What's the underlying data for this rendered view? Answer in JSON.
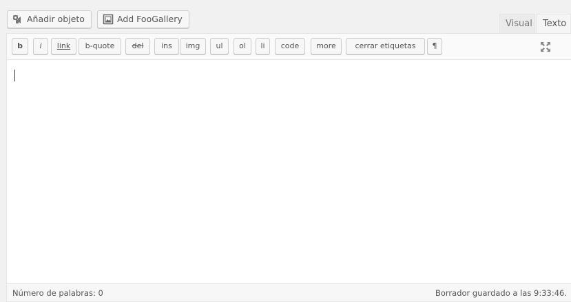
{
  "media_buttons": {
    "add_media": {
      "label": "Añadir objeto",
      "icon": "media-icon"
    },
    "add_foogallery": {
      "label": "Add FooGallery",
      "icon": "gallery-icon"
    }
  },
  "editor_tabs": {
    "visual": "Visual",
    "text": "Texto",
    "active": "Texto"
  },
  "quicktags": {
    "b": "b",
    "i": "i",
    "link": "link",
    "b_quote": "b-quote",
    "del": "del",
    "ins": "ins",
    "img": "img",
    "ul": "ul",
    "ol": "ol",
    "li": "li",
    "code": "code",
    "more": "more",
    "close_tags": "cerrar etiquetas",
    "paragraph": "¶"
  },
  "fullscreen": {
    "icon": "fullscreen-icon"
  },
  "content": {
    "value": ""
  },
  "status_bar": {
    "word_count": "Número de palabras: 0",
    "draft_status": "Borrador guardado a las 9:33:46."
  },
  "colors": {
    "background": "#f1f1f1",
    "editor_bg": "#ffffff",
    "toolbar_bg": "#fafafa",
    "border": "#e5e5e5",
    "button_bg": "#f7f7f7",
    "text": "#555555"
  }
}
